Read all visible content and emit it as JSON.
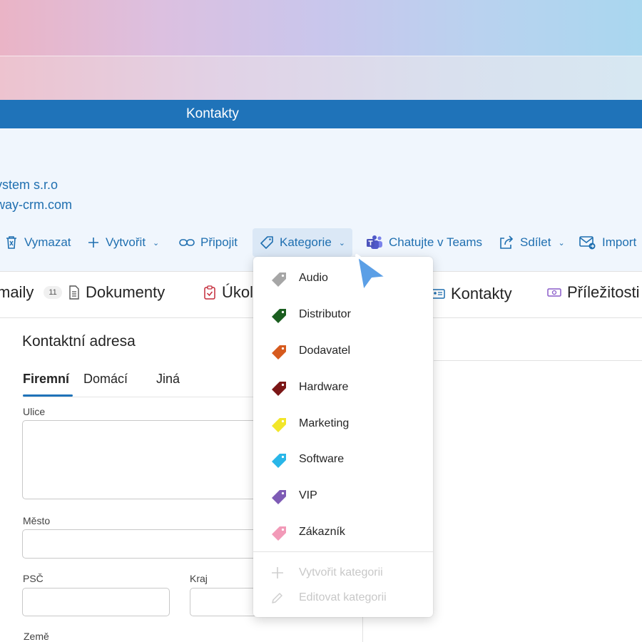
{
  "window": {
    "title": "Kontakty"
  },
  "company": {
    "name": "ystem s.r.o",
    "website": "way-crm.com"
  },
  "toolbar": {
    "delete": "Vymazat",
    "create": "Vytvořit",
    "attach": "Připojit",
    "category": "Kategorie",
    "teams": "Chatujte v Teams",
    "share": "Sdílet",
    "import": "Import"
  },
  "tabs": {
    "emails": "maily",
    "emails_count": "11",
    "documents": "Dokumenty",
    "tasks": "Úkol",
    "contacts": "Kontakty",
    "opportunities": "Příležitosti"
  },
  "form": {
    "title": "Kontaktní adresa",
    "subtabs": [
      "Firemní",
      "Domácí",
      "Jiná"
    ],
    "street_label": "Ulice",
    "city_label": "Město",
    "zip_label": "PSČ",
    "region_label": "Kraj",
    "country_label": "Země"
  },
  "category_menu": {
    "items": [
      {
        "label": "Audio",
        "color": "#a6a6a6"
      },
      {
        "label": "Distributor",
        "color": "#1b5e20"
      },
      {
        "label": "Dodavatel",
        "color": "#d65a1e"
      },
      {
        "label": "Hardware",
        "color": "#7b1616"
      },
      {
        "label": "Marketing",
        "color": "#f2e629"
      },
      {
        "label": "Software",
        "color": "#29b6e8"
      },
      {
        "label": "VIP",
        "color": "#7e5bb5"
      },
      {
        "label": "Zákazník",
        "color": "#f29ab8"
      }
    ],
    "create": "Vytvořit kategorii",
    "edit": "Editovat kategorii"
  }
}
